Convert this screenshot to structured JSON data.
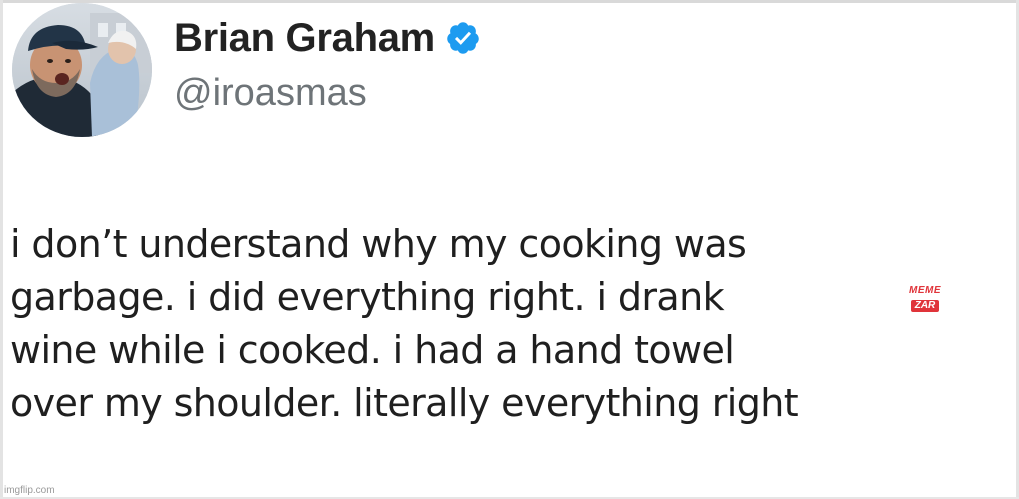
{
  "tweet": {
    "author": {
      "display_name": "Brian Graham",
      "handle": "@iroasmas",
      "verified": true,
      "verified_color": "#1d9bf0",
      "avatar_icon": "profile-photo"
    },
    "text_lines": [
      "i don’t understand why my cooking was",
      "garbage. i did everything right. i drank",
      "wine while i cooked. i had a hand towel",
      "over my shoulder. literally everything right"
    ]
  },
  "watermarks": {
    "memezar_top": "MEME",
    "memezar_bottom": "ZAR",
    "memezar_color": "#e0343a",
    "imgflip": "imgflip.com"
  }
}
